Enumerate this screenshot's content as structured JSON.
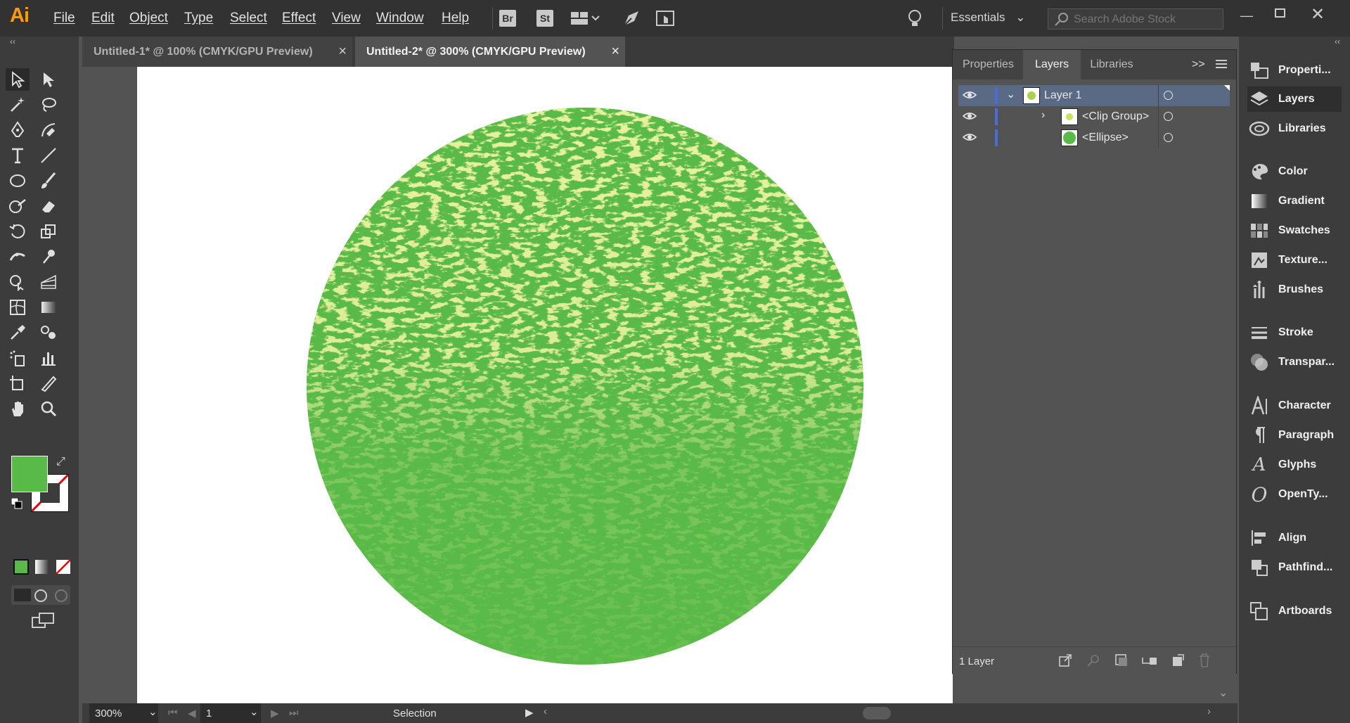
{
  "app": {
    "logo": "Ai"
  },
  "menu": [
    "File",
    "Edit",
    "Object",
    "Type",
    "Select",
    "Effect",
    "View",
    "Window",
    "Help"
  ],
  "app_buttons": {
    "bridge": "Br",
    "stock": "St"
  },
  "workspace": {
    "label": "Essentials"
  },
  "search": {
    "placeholder": "Search Adobe Stock"
  },
  "tabs": [
    {
      "label": "Untitled-1* @ 100% (CMYK/GPU Preview)",
      "close": "×"
    },
    {
      "label": "Untitled-2* @ 300% (CMYK/GPU Preview)",
      "close": "×"
    }
  ],
  "layers_panel": {
    "tabs": [
      "Properties",
      "Layers",
      "Libraries"
    ],
    "rows": [
      {
        "name": "Layer 1"
      },
      {
        "name": "<Clip Group>"
      },
      {
        "name": "<Ellipse>"
      }
    ],
    "footer": "1 Layer"
  },
  "dock": [
    "Properti...",
    "Layers",
    "Libraries",
    "Color",
    "Gradient",
    "Swatches",
    "Texture...",
    "Brushes",
    "Stroke",
    "Transpar...",
    "Character",
    "Paragraph",
    "Glyphs",
    "OpenTy...",
    "Align",
    "Pathfind...",
    "Artboards"
  ],
  "status": {
    "zoom": "300%",
    "artboard": "1",
    "tool": "Selection"
  },
  "colors": {
    "fill": "#5aba47",
    "texture": "#d4e35a",
    "accent_layer": "#4a6bd8",
    "selection_row": "#5a6a84"
  }
}
